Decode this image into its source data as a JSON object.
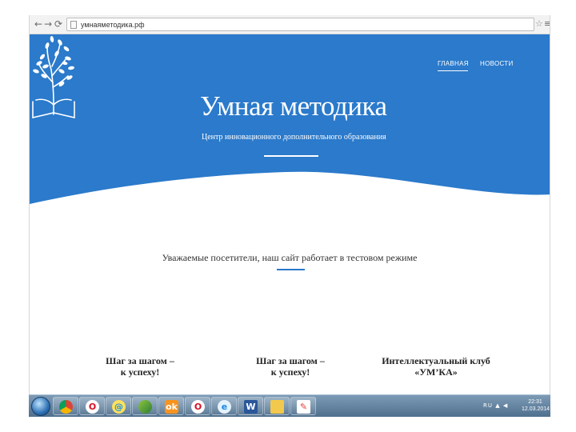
{
  "browser": {
    "url": "умнаяметодика.рф",
    "back_icon": "arrow-left-icon",
    "forward_icon": "arrow-right-icon",
    "reload_icon": "reload-icon",
    "star_icon": "star-icon",
    "menu_icon": "menu-icon"
  },
  "site": {
    "nav": [
      {
        "label": "ГЛАВНАЯ"
      },
      {
        "label": "НОВОСТИ"
      }
    ],
    "title": "Умная методика",
    "subtitle": "Центр инновационного дополнительного образования",
    "notice": "Уважаемые посетители, наш сайт работает в тестовом режиме",
    "cards": [
      {
        "title_line1": "Шаг за шагом –",
        "title_line2": "к успеху!"
      },
      {
        "title_line1": "Шаг за шагом –",
        "title_line2": "к успеху!"
      },
      {
        "title_line1": "Интеллектуальный клуб",
        "title_line2": "«УМ’КА»"
      }
    ]
  },
  "colors": {
    "brand_blue": "#2b7acb",
    "text_dark": "#222222",
    "taskbar": "#5e7f9c"
  },
  "taskbar": {
    "start_icon": "windows-start-icon",
    "apps": [
      {
        "name": "chrome-icon"
      },
      {
        "name": "opera-icon"
      },
      {
        "name": "mail-agent-icon"
      },
      {
        "name": "green-app-icon"
      },
      {
        "name": "odnoklassniki-icon"
      },
      {
        "name": "opera-icon"
      },
      {
        "name": "internet-explorer-icon"
      },
      {
        "name": "word-icon"
      },
      {
        "name": "folder-icon"
      },
      {
        "name": "paint-icon"
      }
    ],
    "tray": "RU",
    "clock_time": "22:31",
    "clock_date": "12.03.2014"
  }
}
